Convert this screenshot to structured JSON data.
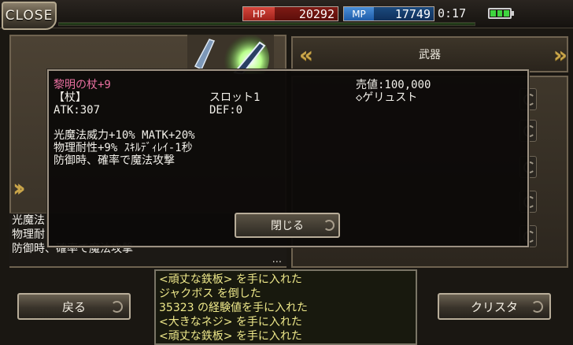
{
  "topbar": {
    "close_label": "CLOSE",
    "hp_label": "HP",
    "hp_value": "20292",
    "mp_label": "MP",
    "mp_value": "17749",
    "time": "0:17"
  },
  "background": {
    "item_desc_lines": [
      "光魔法",
      "物理耐",
      "防御時、確率で魔法攻撃"
    ],
    "more_indicator": "...",
    "category_label": "武器"
  },
  "modal": {
    "item_name": "黎明の杖+9",
    "type": "【杖】",
    "slot": "スロット1",
    "sell_price": "売値:100,000",
    "maker": "◇ゲリュスト",
    "atk": "ATK:307",
    "def": "DEF:0",
    "effects": [
      "光魔法威力+10% MATK+20%",
      "物理耐性+9% ｽｷﾙﾃﾞｨﾚｲ-1秒",
      "防御時、確率で魔法攻撃"
    ],
    "close_button": "閉じる"
  },
  "bottom": {
    "back_button": "戻る",
    "crysta_button": "クリスタ",
    "log": [
      "<頑丈な鉄板> を手に入れた",
      "ジャクボス を倒した",
      "35323 の経験値を手に入れた",
      "<大きなネジ> を手に入れた",
      "<頑丈な鉄板> を手に入れた"
    ]
  },
  "colors": {
    "item_name": "#e96fa0",
    "log_text": "#efe98a",
    "hp": "#d6463c",
    "mp": "#4a8ed8",
    "accent_arrow": "#c9a54a"
  }
}
